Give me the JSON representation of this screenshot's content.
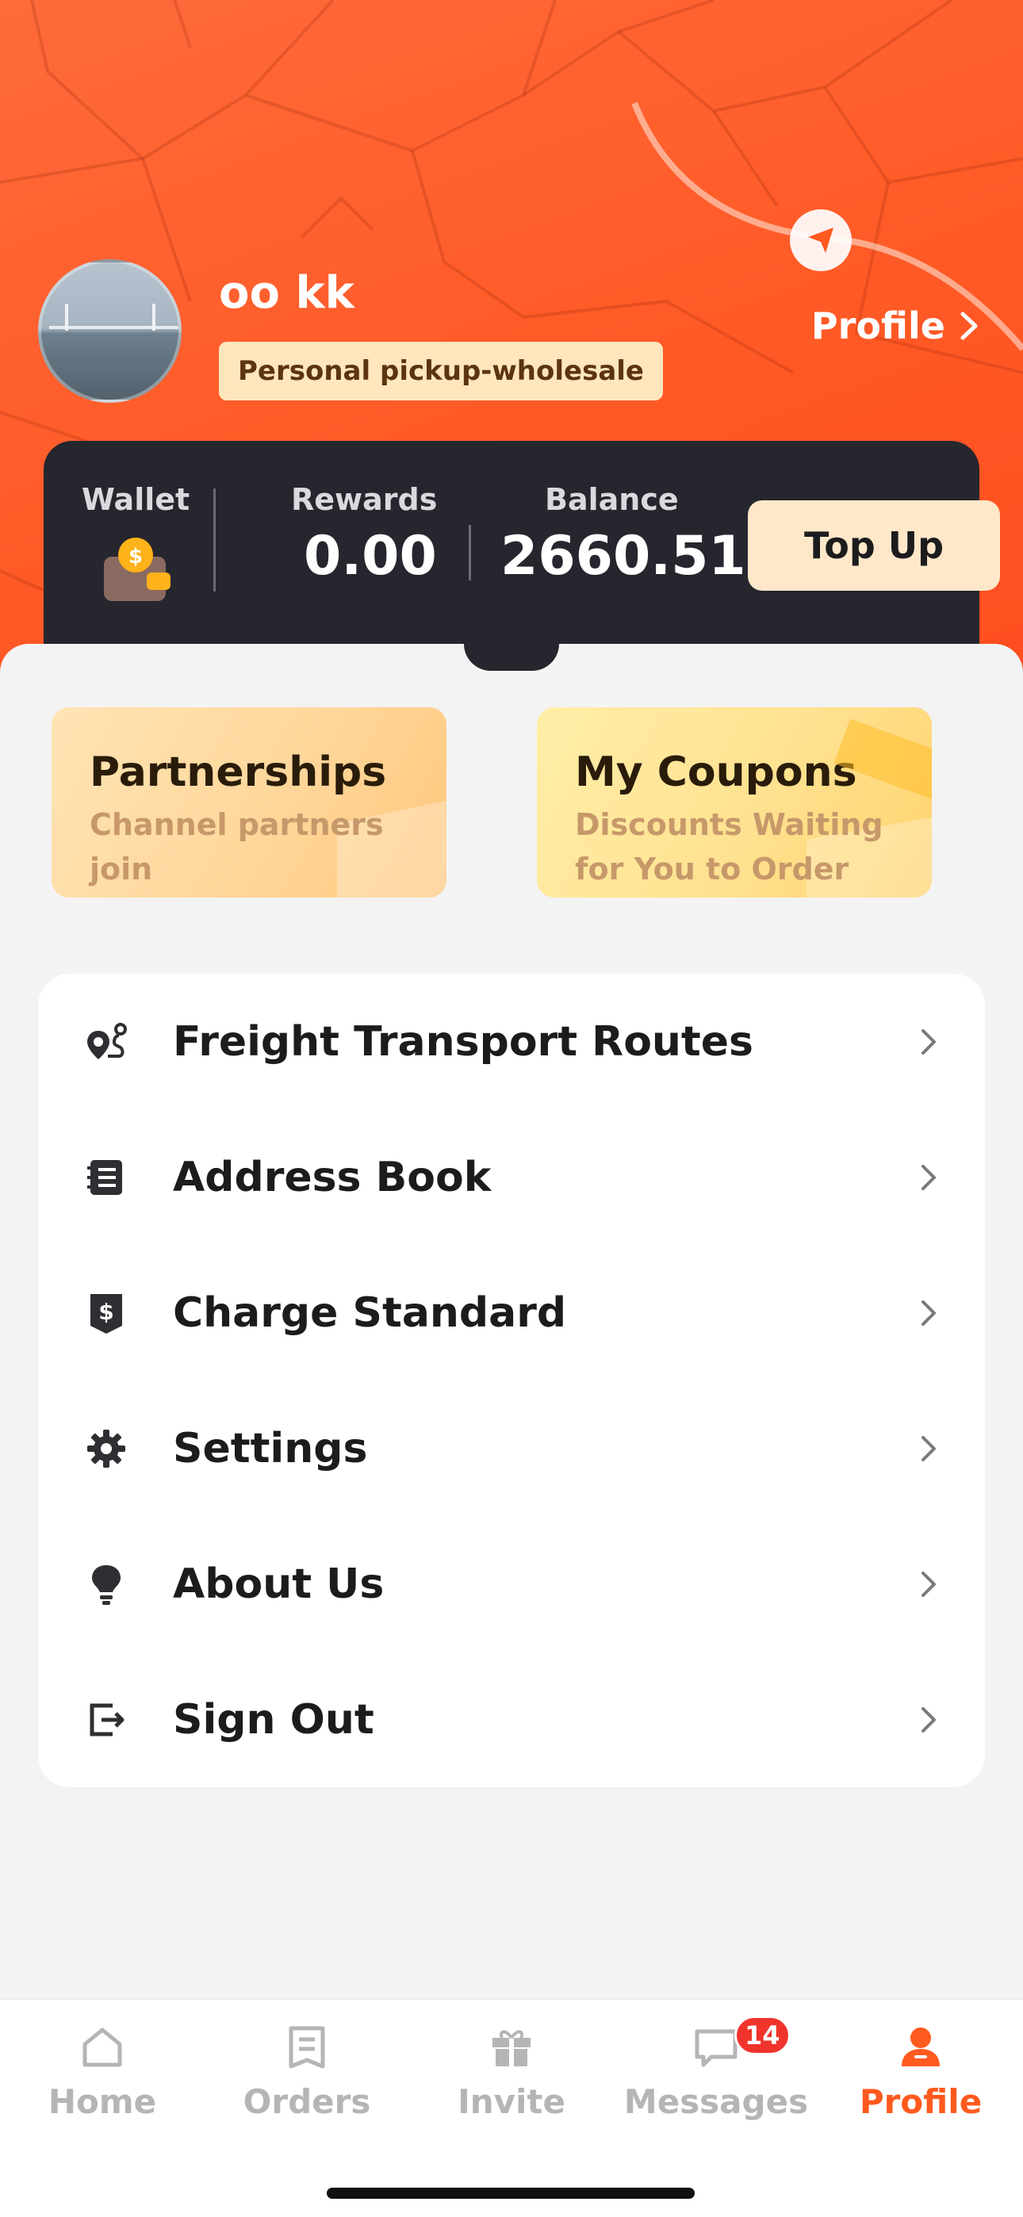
{
  "header": {
    "username": "oo kk",
    "role_badge": "Personal pickup-wholesale",
    "profile_link": "Profile"
  },
  "wallet": {
    "wallet_label": "Wallet",
    "rewards_label": "Rewards",
    "rewards_value": "0.00",
    "balance_label": "Balance",
    "balance_value": "2660.51",
    "topup_label": "Top Up"
  },
  "promos": [
    {
      "title": "Partnerships",
      "subtitle": "Channel partners join"
    },
    {
      "title": "My Coupons",
      "subtitle": "Discounts Waiting for You to Order"
    }
  ],
  "menu": {
    "items": [
      {
        "label": "Freight Transport Routes",
        "icon": "route-pin-icon"
      },
      {
        "label": "Address Book",
        "icon": "address-book-icon"
      },
      {
        "label": "Charge Standard",
        "icon": "dollar-tag-icon"
      },
      {
        "label": "Settings",
        "icon": "gear-icon"
      },
      {
        "label": "About Us",
        "icon": "lightbulb-icon"
      },
      {
        "label": "Sign Out",
        "icon": "sign-out-icon"
      }
    ]
  },
  "tabbar": {
    "tabs": [
      {
        "label": "Home",
        "icon": "home-icon"
      },
      {
        "label": "Orders",
        "icon": "orders-icon"
      },
      {
        "label": "Invite",
        "icon": "gift-icon"
      },
      {
        "label": "Messages",
        "icon": "message-icon",
        "badge": "14"
      },
      {
        "label": "Profile",
        "icon": "person-icon",
        "active": true
      }
    ]
  },
  "colors": {
    "brand_orange": "#ff5a1f",
    "wallet_dark": "#26262e",
    "badge_red": "#f0342c",
    "badge_cream": "#ffe6bd"
  }
}
